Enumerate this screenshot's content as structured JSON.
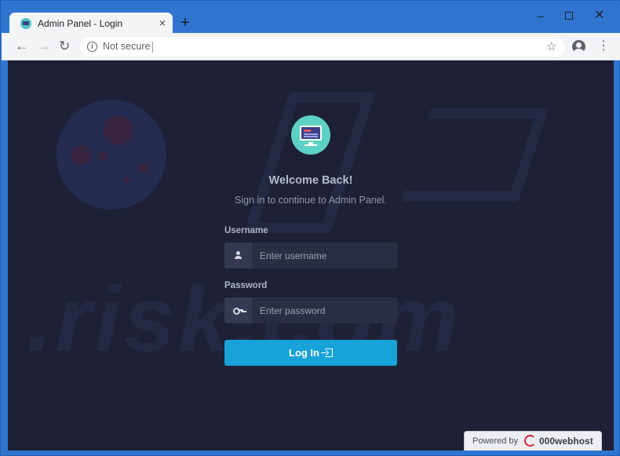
{
  "browser": {
    "tab_title": "Admin Panel - Login",
    "tab_close": "×",
    "new_tab": "+",
    "window_minimize": "–",
    "window_close": "✕",
    "nav_back": "←",
    "nav_forward": "→",
    "nav_reload": "↻",
    "security_info": "i",
    "security_text": "Not secure",
    "bookmark_star": "☆",
    "menu": "⋮"
  },
  "watermark": {
    "text": ".risk.com"
  },
  "login": {
    "welcome": "Welcome Back!",
    "subtitle": "Sign in to continue to Admin Panel.",
    "username_label": "Username",
    "username_placeholder": "Enter username",
    "password_label": "Password",
    "password_placeholder": "Enter password",
    "login_button": "Log In"
  },
  "footer": {
    "powered_by": "Powered by",
    "brand": "000webhost"
  },
  "colors": {
    "page_background": "#1e2136",
    "accent_button": "#17a2d8",
    "logo_circle": "#5ed1c6",
    "browser_frame": "#2f75d0"
  }
}
